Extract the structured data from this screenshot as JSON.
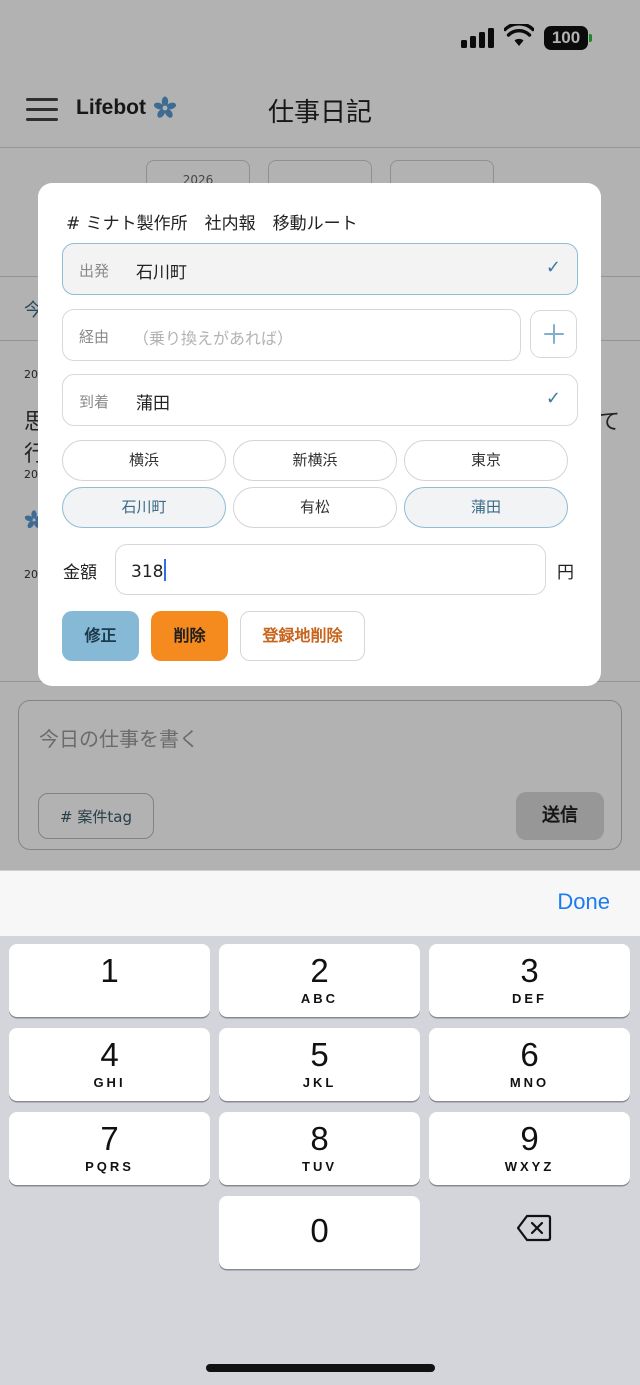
{
  "status": {
    "battery": "100"
  },
  "header": {
    "brand": "Lifebot",
    "title": "仕事日記"
  },
  "date_tabs": [
    "2026",
    "",
    ""
  ],
  "background": {
    "tab_fragment": "今",
    "date_fragments": [
      "20",
      "20",
      "20"
    ],
    "text_fragment_left_1": "思",
    "text_fragment_left_2": "行",
    "text_fragment_right": "て"
  },
  "modal": {
    "title": "# ミナト製作所　社内報　移動ルート",
    "departure": {
      "label": "出発",
      "value": "石川町"
    },
    "via": {
      "label": "経由",
      "placeholder": "（乗り換えがあれば）"
    },
    "arrival": {
      "label": "到着",
      "value": "蒲田"
    },
    "stations": [
      "横浜",
      "新横浜",
      "東京",
      "石川町",
      "有松",
      "蒲田"
    ],
    "amount": {
      "label": "金額",
      "value": "318",
      "unit": "円"
    },
    "buttons": {
      "edit": "修正",
      "delete": "削除",
      "delete_registered": "登録地削除"
    }
  },
  "composer": {
    "placeholder": "今日の仕事を書く",
    "tag_button": "# 案件tag",
    "send_button": "送信"
  },
  "keyboard": {
    "done": "Done",
    "keys": [
      {
        "digit": "1",
        "letters": ""
      },
      {
        "digit": "2",
        "letters": "ABC"
      },
      {
        "digit": "3",
        "letters": "DEF"
      },
      {
        "digit": "4",
        "letters": "GHI"
      },
      {
        "digit": "5",
        "letters": "JKL"
      },
      {
        "digit": "6",
        "letters": "MNO"
      },
      {
        "digit": "7",
        "letters": "PQRS"
      },
      {
        "digit": "8",
        "letters": "TUV"
      },
      {
        "digit": "9",
        "letters": "WXYZ"
      },
      {
        "digit": "0",
        "letters": ""
      }
    ]
  },
  "colors": {
    "accent_blue": "#86b9d6",
    "delete_orange": "#f58a1f",
    "done_blue": "#1a7cf0",
    "flower_blue": "#5a9ad0"
  },
  "icons": {
    "menu": "hamburger-icon",
    "brand": "flower-icon",
    "check": "checkmark-icon",
    "add": "plus-icon",
    "backspace": "backspace-icon"
  }
}
